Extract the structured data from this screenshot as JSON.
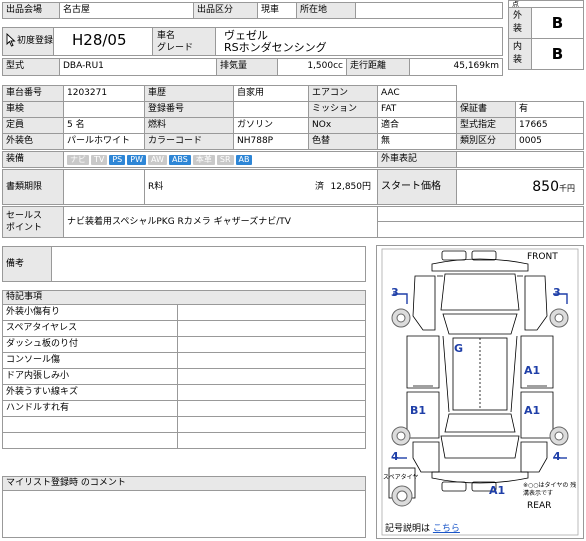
{
  "header": {
    "venue_label": "出品会場",
    "venue": "名古屋",
    "category_label": "出品区分",
    "category": "現車",
    "location_label": "所在地",
    "location": ""
  },
  "grade_panel": {
    "rows": [
      {
        "label": "外装",
        "value": "B"
      },
      {
        "label": "内装",
        "value": "B"
      }
    ],
    "top_label": "点"
  },
  "reg": {
    "label": "初度登録",
    "year": "H28/05",
    "name_label": "車名",
    "grade_label": "グレード",
    "name": "ヴェゼル",
    "grade": "RSホンダセンシング"
  },
  "model": {
    "type_label": "型式",
    "type": "DBA-RU1",
    "disp_label": "排気量",
    "disp": "1,500cc",
    "mileage_label": "走行距離",
    "mileage": "45,169km"
  },
  "spec_rows": [
    [
      "車台番号",
      "1203271",
      "車歴",
      "",
      "自家用",
      "エアコン",
      "AAC",
      "",
      ""
    ],
    [
      "車検",
      "",
      "登録番号",
      "",
      "",
      "ミッション",
      "FAT",
      "保証書",
      "有"
    ],
    [
      "定員",
      "5 名",
      "燃料",
      "ガソリン",
      "",
      "NOx",
      "",
      "適合",
      "型式指定",
      "17665"
    ],
    [
      "外装色",
      "パールホワイト",
      "カラーコード",
      "NH788P",
      "",
      "色替",
      "無",
      "類別区分",
      "0005"
    ]
  ],
  "spec": {
    "chassis_label": "車台番号",
    "chassis": "1203271",
    "history_label": "車歴",
    "history": "",
    "use": "自家用",
    "ac_label": "エアコン",
    "ac": "AAC",
    "inspect_label": "車検",
    "inspect": "",
    "regno_label": "登録番号",
    "regno": "",
    "mission_label": "ミッション",
    "mission": "FAT",
    "warranty_label": "保証書",
    "warranty": "有",
    "cap_label": "定員",
    "cap": "5 名",
    "fuel_label": "燃料",
    "fuel": "ガソリン",
    "nox_label": "NOx",
    "nox": "",
    "nox_fit": "適合",
    "typeno_label": "型式指定",
    "typeno": "17665",
    "color_label": "外装色",
    "color": "パールホワイト",
    "code_label": "カラーコード",
    "code": "NH788P",
    "repaint_label": "色替",
    "repaint": "無",
    "class_label": "類別区分",
    "class": "0005"
  },
  "equip": {
    "label": "装備",
    "items": [
      {
        "name": "ナビ",
        "on": false
      },
      {
        "name": "TV",
        "on": false
      },
      {
        "name": "PS",
        "on": true
      },
      {
        "name": "PW",
        "on": true
      },
      {
        "name": "AW",
        "on": false
      },
      {
        "name": "ABS",
        "on": true
      },
      {
        "name": "本革",
        "on": false
      },
      {
        "name": "SR",
        "on": false
      },
      {
        "name": "AB",
        "on": true
      }
    ],
    "ext_label": "外車表記"
  },
  "docs": {
    "label": "書類期限",
    "r_label": "R料",
    "r_status": "済",
    "r_value": "12,850円",
    "start_label": "スタート価格",
    "start_value": "850",
    "start_unit": "千円"
  },
  "sales": {
    "label1": "セールス",
    "label2": "ポイント",
    "text": "ナビ装着用スペシャルPKG Rカメラ ギャザーズナビ/TV"
  },
  "notes": {
    "label": "備考"
  },
  "special": {
    "label": "特記事項",
    "items": [
      "外装小傷有り",
      "スペアタイヤレス",
      "ダッシュ板のり付",
      "コンソール傷",
      "ドア内張しみ小",
      "外装うすい線キズ",
      "ハンドルすれ有",
      "",
      ""
    ]
  },
  "mylist": {
    "label": "マイリスト登録時 のコメント"
  },
  "diagram": {
    "front": "FRONT",
    "rear": "REAR",
    "marks": [
      "3",
      "3",
      "G",
      "A1",
      "B1",
      "A1",
      "4",
      "4",
      "A1"
    ],
    "spare_label": "スペアタイヤ",
    "note": "※○○はタイヤの 残溝表示です",
    "legend_label": "記号説明は",
    "legend_link": "こちら"
  },
  "colors": {
    "badge_on": "#2e86d6",
    "badge_off": "#c9c9c9",
    "mark": "#1f3fa8"
  }
}
